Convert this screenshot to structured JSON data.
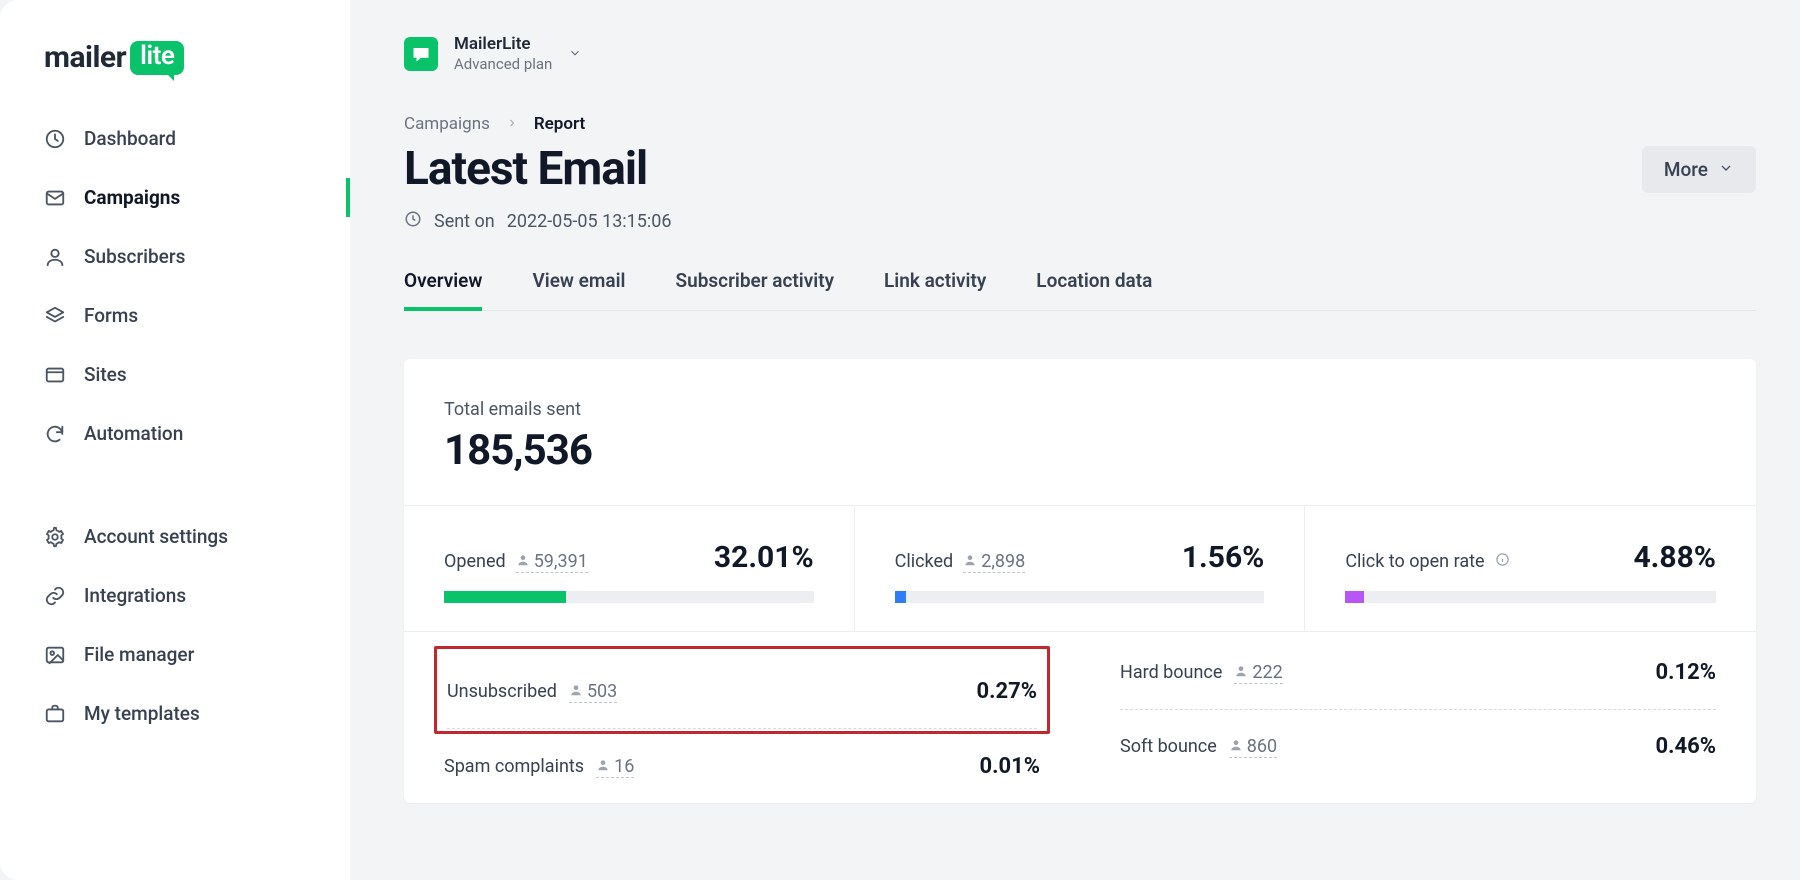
{
  "brand": {
    "word1": "mailer",
    "word2": "lite"
  },
  "account": {
    "name": "MailerLite",
    "plan": "Advanced plan"
  },
  "sidebar": {
    "items": [
      {
        "label": "Dashboard"
      },
      {
        "label": "Campaigns"
      },
      {
        "label": "Subscribers"
      },
      {
        "label": "Forms"
      },
      {
        "label": "Sites"
      },
      {
        "label": "Automation"
      }
    ],
    "secondary": [
      {
        "label": "Account settings"
      },
      {
        "label": "Integrations"
      },
      {
        "label": "File manager"
      },
      {
        "label": "My templates"
      }
    ],
    "activeIndex": 1
  },
  "breadcrumb": {
    "root": "Campaigns",
    "current": "Report"
  },
  "page": {
    "title": "Latest Email",
    "sent_prefix": "Sent on",
    "sent_at": "2022-05-05 13:15:06",
    "more_label": "More"
  },
  "tabs": [
    {
      "label": "Overview",
      "active": true
    },
    {
      "label": "View email"
    },
    {
      "label": "Subscriber activity"
    },
    {
      "label": "Link activity"
    },
    {
      "label": "Location data"
    }
  ],
  "totals": {
    "label": "Total emails sent",
    "value": "185,536"
  },
  "metrics": {
    "opened": {
      "label": "Opened",
      "count": "59,391",
      "pct": "32.01%",
      "fill": 33,
      "color": "#09c269"
    },
    "clicked": {
      "label": "Clicked",
      "count": "2,898",
      "pct": "1.56%",
      "fill": 3,
      "color": "#2e7cf6"
    },
    "ctor": {
      "label": "Click to open rate",
      "pct": "4.88%",
      "fill": 5,
      "color": "#b755f5"
    }
  },
  "stats": {
    "unsubscribed": {
      "label": "Unsubscribed",
      "count": "503",
      "pct": "0.27%"
    },
    "spam": {
      "label": "Spam complaints",
      "count": "16",
      "pct": "0.01%"
    },
    "hard_bounce": {
      "label": "Hard bounce",
      "count": "222",
      "pct": "0.12%"
    },
    "soft_bounce": {
      "label": "Soft bounce",
      "count": "860",
      "pct": "0.46%"
    }
  }
}
